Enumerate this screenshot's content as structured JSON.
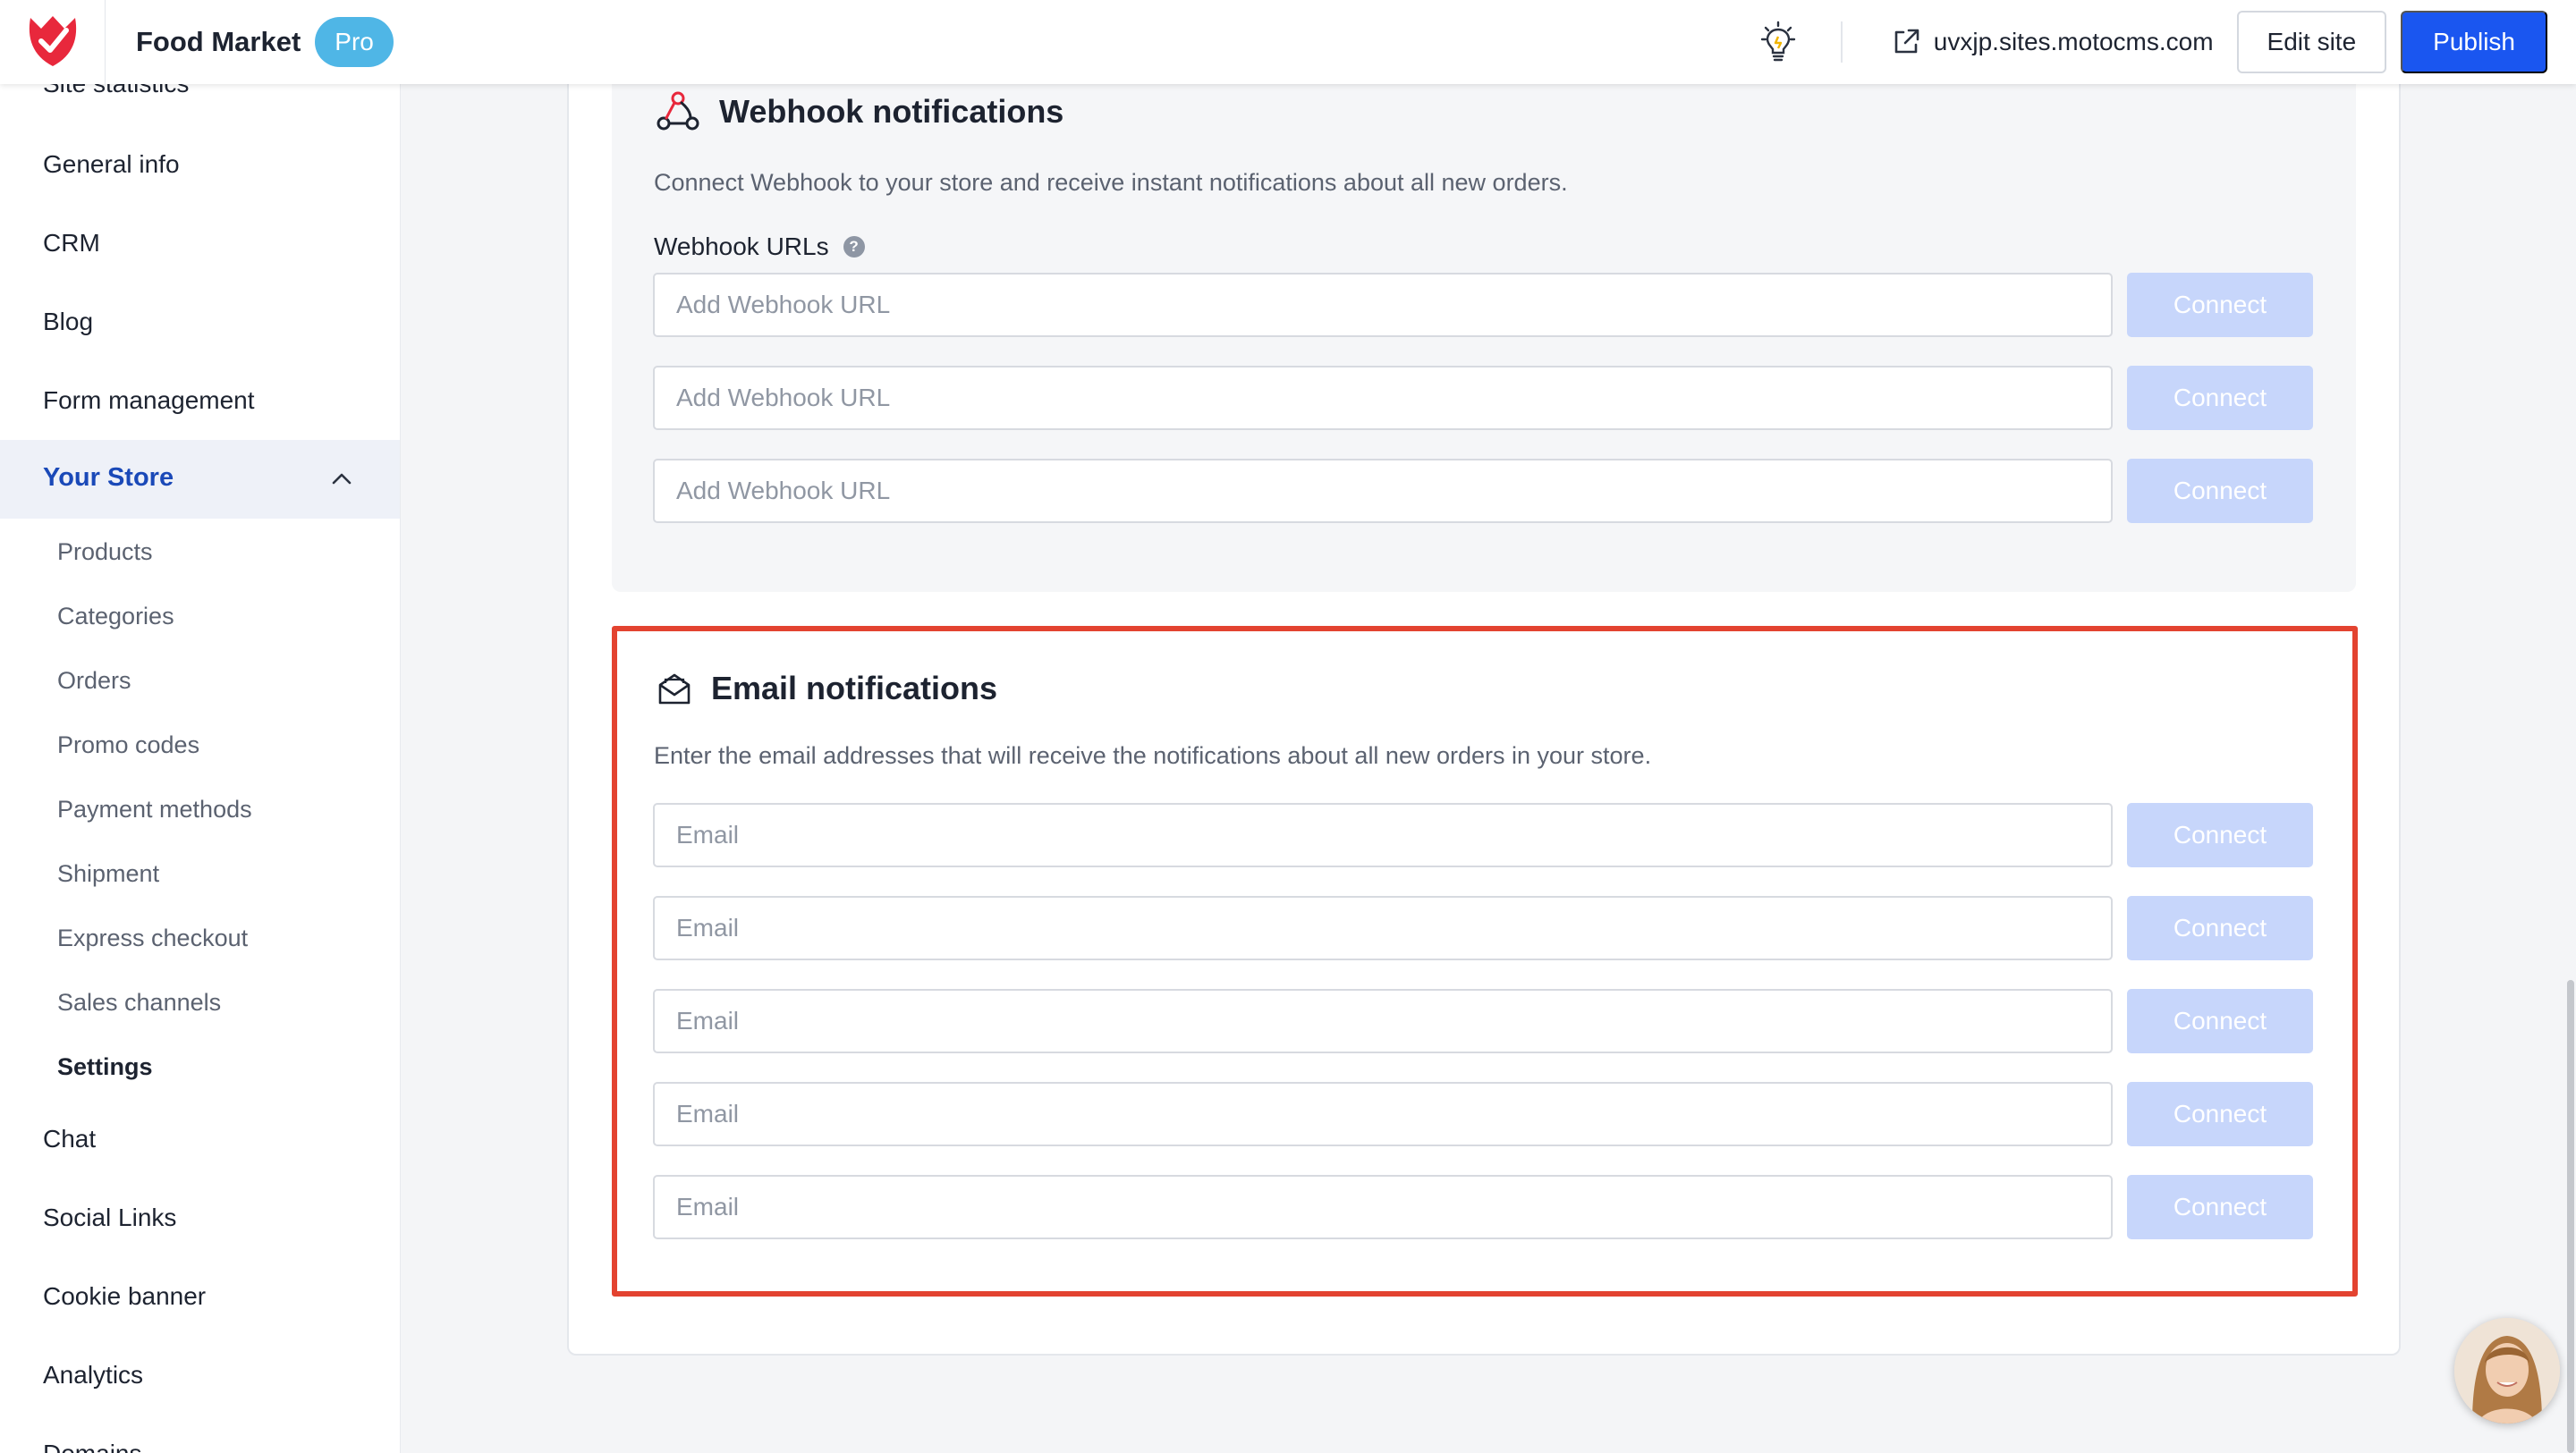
{
  "app": {
    "site_title": "Food Market",
    "plan_badge": "Pro",
    "site_url": "uvxjp.sites.motocms.com",
    "edit_label": "Edit site",
    "publish_label": "Publish",
    "brand_color": "#e8283c",
    "accent_color": "#1a56f0"
  },
  "sidebar": {
    "items_top": [
      {
        "label": "Site statistics"
      },
      {
        "label": "General info"
      },
      {
        "label": "CRM"
      },
      {
        "label": "Blog"
      },
      {
        "label": "Form management"
      }
    ],
    "store_section": {
      "label": "Your Store",
      "expanded": true,
      "children": [
        {
          "label": "Products"
        },
        {
          "label": "Categories"
        },
        {
          "label": "Orders"
        },
        {
          "label": "Promo codes"
        },
        {
          "label": "Payment methods"
        },
        {
          "label": "Shipment"
        },
        {
          "label": "Express checkout"
        },
        {
          "label": "Sales channels"
        },
        {
          "label": "Settings",
          "active": true
        }
      ]
    },
    "items_bottom": [
      {
        "label": "Chat"
      },
      {
        "label": "Social Links"
      },
      {
        "label": "Cookie banner"
      },
      {
        "label": "Analytics"
      },
      {
        "label": "Domains"
      }
    ]
  },
  "webhook": {
    "title": "Webhook notifications",
    "description": "Connect Webhook to your store and receive instant notifications about all new orders.",
    "field_label": "Webhook URLs",
    "help_glyph": "?",
    "placeholder": "Add Webhook URL",
    "button_label": "Connect",
    "icon": "webhook-icon"
  },
  "email": {
    "title": "Email notifications",
    "description": "Enter the email addresses that will receive the notifications about all new orders in your store.",
    "placeholder": "Email",
    "button_label": "Connect",
    "icon": "envelope-open-icon",
    "highlight_color": "#e34330"
  }
}
